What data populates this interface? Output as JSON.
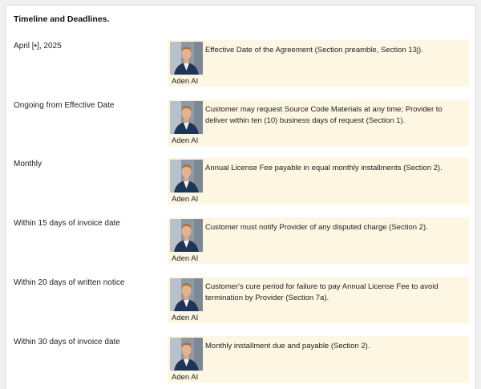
{
  "section": {
    "title": "Timeline and Deadlines."
  },
  "entries": [
    {
      "date": "April [•], 2025",
      "author": "Aden AI",
      "text": "Effective Date of the Agreement (Section preamble, Section 13j)."
    },
    {
      "date": "Ongoing from Effective Date",
      "author": "Aden AI",
      "text": "Customer may request Source Code Materials at any time; Provider to deliver within ten (10) business days of request (Section 1)."
    },
    {
      "date": "Monthly",
      "author": "Aden AI",
      "text": "Annual License Fee payable in equal monthly installments (Section 2)."
    },
    {
      "date": "Within 15 days of invoice date",
      "author": "Aden AI",
      "text": "Customer must notify Provider of any disputed charge (Section 2)."
    },
    {
      "date": "Within 20 days of written notice",
      "author": "Aden AI",
      "text": "Customer's cure period for failure to pay Annual License Fee to avoid termination by Provider (Section 7a)."
    },
    {
      "date": "Within 30 days of invoice date",
      "author": "Aden AI",
      "text": "Monthly installment due and payable (Section 2)."
    }
  ]
}
